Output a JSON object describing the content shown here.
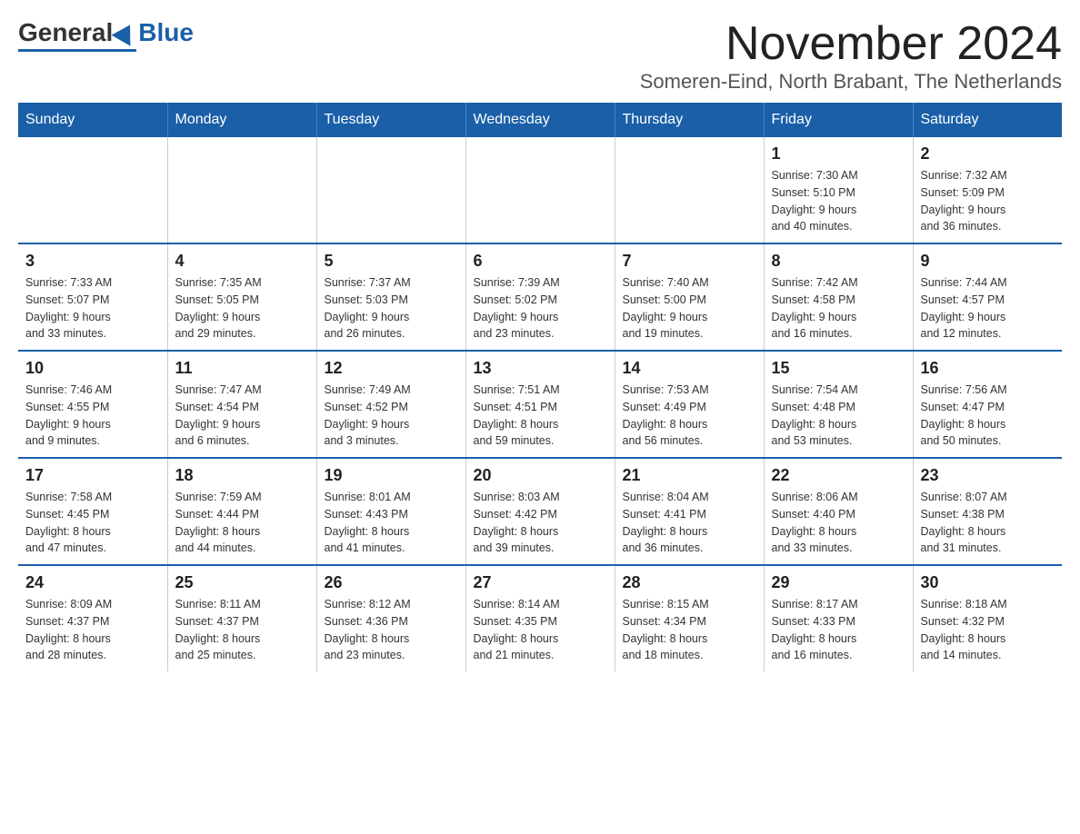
{
  "header": {
    "logo_general": "General",
    "logo_blue": "Blue",
    "month_title": "November 2024",
    "location": "Someren-Eind, North Brabant, The Netherlands"
  },
  "weekdays": [
    "Sunday",
    "Monday",
    "Tuesday",
    "Wednesday",
    "Thursday",
    "Friday",
    "Saturday"
  ],
  "weeks": [
    [
      {
        "day": "",
        "info": ""
      },
      {
        "day": "",
        "info": ""
      },
      {
        "day": "",
        "info": ""
      },
      {
        "day": "",
        "info": ""
      },
      {
        "day": "",
        "info": ""
      },
      {
        "day": "1",
        "info": "Sunrise: 7:30 AM\nSunset: 5:10 PM\nDaylight: 9 hours\nand 40 minutes."
      },
      {
        "day": "2",
        "info": "Sunrise: 7:32 AM\nSunset: 5:09 PM\nDaylight: 9 hours\nand 36 minutes."
      }
    ],
    [
      {
        "day": "3",
        "info": "Sunrise: 7:33 AM\nSunset: 5:07 PM\nDaylight: 9 hours\nand 33 minutes."
      },
      {
        "day": "4",
        "info": "Sunrise: 7:35 AM\nSunset: 5:05 PM\nDaylight: 9 hours\nand 29 minutes."
      },
      {
        "day": "5",
        "info": "Sunrise: 7:37 AM\nSunset: 5:03 PM\nDaylight: 9 hours\nand 26 minutes."
      },
      {
        "day": "6",
        "info": "Sunrise: 7:39 AM\nSunset: 5:02 PM\nDaylight: 9 hours\nand 23 minutes."
      },
      {
        "day": "7",
        "info": "Sunrise: 7:40 AM\nSunset: 5:00 PM\nDaylight: 9 hours\nand 19 minutes."
      },
      {
        "day": "8",
        "info": "Sunrise: 7:42 AM\nSunset: 4:58 PM\nDaylight: 9 hours\nand 16 minutes."
      },
      {
        "day": "9",
        "info": "Sunrise: 7:44 AM\nSunset: 4:57 PM\nDaylight: 9 hours\nand 12 minutes."
      }
    ],
    [
      {
        "day": "10",
        "info": "Sunrise: 7:46 AM\nSunset: 4:55 PM\nDaylight: 9 hours\nand 9 minutes."
      },
      {
        "day": "11",
        "info": "Sunrise: 7:47 AM\nSunset: 4:54 PM\nDaylight: 9 hours\nand 6 minutes."
      },
      {
        "day": "12",
        "info": "Sunrise: 7:49 AM\nSunset: 4:52 PM\nDaylight: 9 hours\nand 3 minutes."
      },
      {
        "day": "13",
        "info": "Sunrise: 7:51 AM\nSunset: 4:51 PM\nDaylight: 8 hours\nand 59 minutes."
      },
      {
        "day": "14",
        "info": "Sunrise: 7:53 AM\nSunset: 4:49 PM\nDaylight: 8 hours\nand 56 minutes."
      },
      {
        "day": "15",
        "info": "Sunrise: 7:54 AM\nSunset: 4:48 PM\nDaylight: 8 hours\nand 53 minutes."
      },
      {
        "day": "16",
        "info": "Sunrise: 7:56 AM\nSunset: 4:47 PM\nDaylight: 8 hours\nand 50 minutes."
      }
    ],
    [
      {
        "day": "17",
        "info": "Sunrise: 7:58 AM\nSunset: 4:45 PM\nDaylight: 8 hours\nand 47 minutes."
      },
      {
        "day": "18",
        "info": "Sunrise: 7:59 AM\nSunset: 4:44 PM\nDaylight: 8 hours\nand 44 minutes."
      },
      {
        "day": "19",
        "info": "Sunrise: 8:01 AM\nSunset: 4:43 PM\nDaylight: 8 hours\nand 41 minutes."
      },
      {
        "day": "20",
        "info": "Sunrise: 8:03 AM\nSunset: 4:42 PM\nDaylight: 8 hours\nand 39 minutes."
      },
      {
        "day": "21",
        "info": "Sunrise: 8:04 AM\nSunset: 4:41 PM\nDaylight: 8 hours\nand 36 minutes."
      },
      {
        "day": "22",
        "info": "Sunrise: 8:06 AM\nSunset: 4:40 PM\nDaylight: 8 hours\nand 33 minutes."
      },
      {
        "day": "23",
        "info": "Sunrise: 8:07 AM\nSunset: 4:38 PM\nDaylight: 8 hours\nand 31 minutes."
      }
    ],
    [
      {
        "day": "24",
        "info": "Sunrise: 8:09 AM\nSunset: 4:37 PM\nDaylight: 8 hours\nand 28 minutes."
      },
      {
        "day": "25",
        "info": "Sunrise: 8:11 AM\nSunset: 4:37 PM\nDaylight: 8 hours\nand 25 minutes."
      },
      {
        "day": "26",
        "info": "Sunrise: 8:12 AM\nSunset: 4:36 PM\nDaylight: 8 hours\nand 23 minutes."
      },
      {
        "day": "27",
        "info": "Sunrise: 8:14 AM\nSunset: 4:35 PM\nDaylight: 8 hours\nand 21 minutes."
      },
      {
        "day": "28",
        "info": "Sunrise: 8:15 AM\nSunset: 4:34 PM\nDaylight: 8 hours\nand 18 minutes."
      },
      {
        "day": "29",
        "info": "Sunrise: 8:17 AM\nSunset: 4:33 PM\nDaylight: 8 hours\nand 16 minutes."
      },
      {
        "day": "30",
        "info": "Sunrise: 8:18 AM\nSunset: 4:32 PM\nDaylight: 8 hours\nand 14 minutes."
      }
    ]
  ]
}
